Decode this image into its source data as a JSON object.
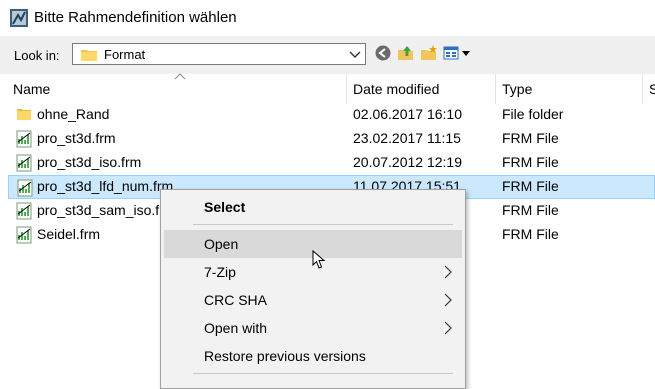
{
  "window": {
    "title": "Bitte Rahmendefinition wählen"
  },
  "toolbar": {
    "look_in_label": "Look in:",
    "folder_value": "Format"
  },
  "columns": [
    "Name",
    "Date modified",
    "Type",
    "S"
  ],
  "files": [
    {
      "name": "ohne_Rand",
      "date": "02.06.2017 16:10",
      "type": "File folder",
      "icon": "folder-icon"
    },
    {
      "name": "pro_st3d.frm",
      "date": "23.02.2017 11:15",
      "type": "FRM File",
      "icon": "frm-file-icon"
    },
    {
      "name": "pro_st3d_iso.frm",
      "date": "20.07.2012 12:19",
      "type": "FRM File",
      "icon": "frm-file-icon"
    },
    {
      "name": "pro_st3d_lfd_num.frm",
      "date": "11.07.2017 15:51",
      "type": "FRM File",
      "icon": "frm-file-icon",
      "selected": true
    },
    {
      "name": "pro_st3d_sam_iso.frm",
      "date": "",
      "type": "FRM File",
      "icon": "frm-file-icon"
    },
    {
      "name": "Seidel.frm",
      "date": "",
      "type": "FRM File",
      "icon": "frm-file-icon"
    }
  ],
  "context_menu": {
    "select": "Select",
    "open": "Open",
    "zip": "7-Zip",
    "crc": "CRC SHA",
    "open_with": "Open with",
    "restore": "Restore previous versions"
  },
  "colors": {
    "selection": "#cce8ff",
    "menu_hover": "#d9d9d9",
    "toolbar_bg": "#f0f0f0"
  }
}
